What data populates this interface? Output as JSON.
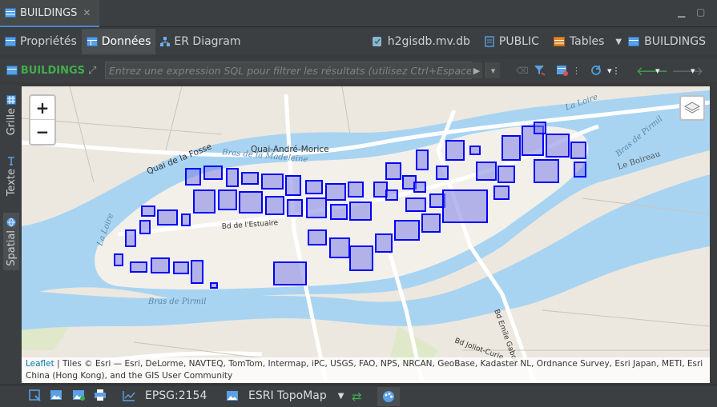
{
  "editor": {
    "tab_title": "BUILDINGS"
  },
  "subtabs": [
    {
      "label": "Propriétés"
    },
    {
      "label": "Données"
    },
    {
      "label": "ER Diagram"
    }
  ],
  "breadcrumb": {
    "database": "h2gisdb.mv.db",
    "schema": "PUBLIC",
    "type": "Tables",
    "table": "BUILDINGS"
  },
  "filter": {
    "table_label": "BUILDINGS",
    "placeholder": "Entrez une expression SQL pour filtrer les résultats (utilisez Ctrl+Espace)"
  },
  "side_tabs": [
    {
      "label": "Grille"
    },
    {
      "label": "Texte"
    },
    {
      "label": "Spatial"
    }
  ],
  "map": {
    "zoom_in": "+",
    "zoom_out": "−",
    "labels": {
      "quai_andre_morice": "Quai-André-Morice",
      "quai_de_la_fosse": "Quai de la Fosse",
      "bras_madeleine": "Bras de la Madeleine",
      "la_loire_left": "La Loire",
      "la_loire_right": "La Loire",
      "bras_de_pirmil_bottom": "Bras de Pirmil",
      "bras_de_pirmil_right": "Bras de Pirmil",
      "le_boireau": "Le Boireau",
      "bd_emile_gabory": "Bd Emile Gabory",
      "bd_jolliot": "Bd Joliot-Curie",
      "bd_estuaire": "Bd de l'Estuaire"
    },
    "attribution_link": "Leaflet",
    "attribution_text": " | Tiles © Esri — Esri, DeLorme, NAVTEQ, TomTom, Intermap, iPC, USGS, FAO, NPS, NRCAN, GeoBase, Kadaster NL, Ordnance Survey, Esri Japan, METI, Esri China (Hong Kong), and the GIS User Community",
    "building_color": "#0000ff"
  },
  "bottom": {
    "crs": "EPSG:2154",
    "basemap": "ESRI TopoMap"
  }
}
